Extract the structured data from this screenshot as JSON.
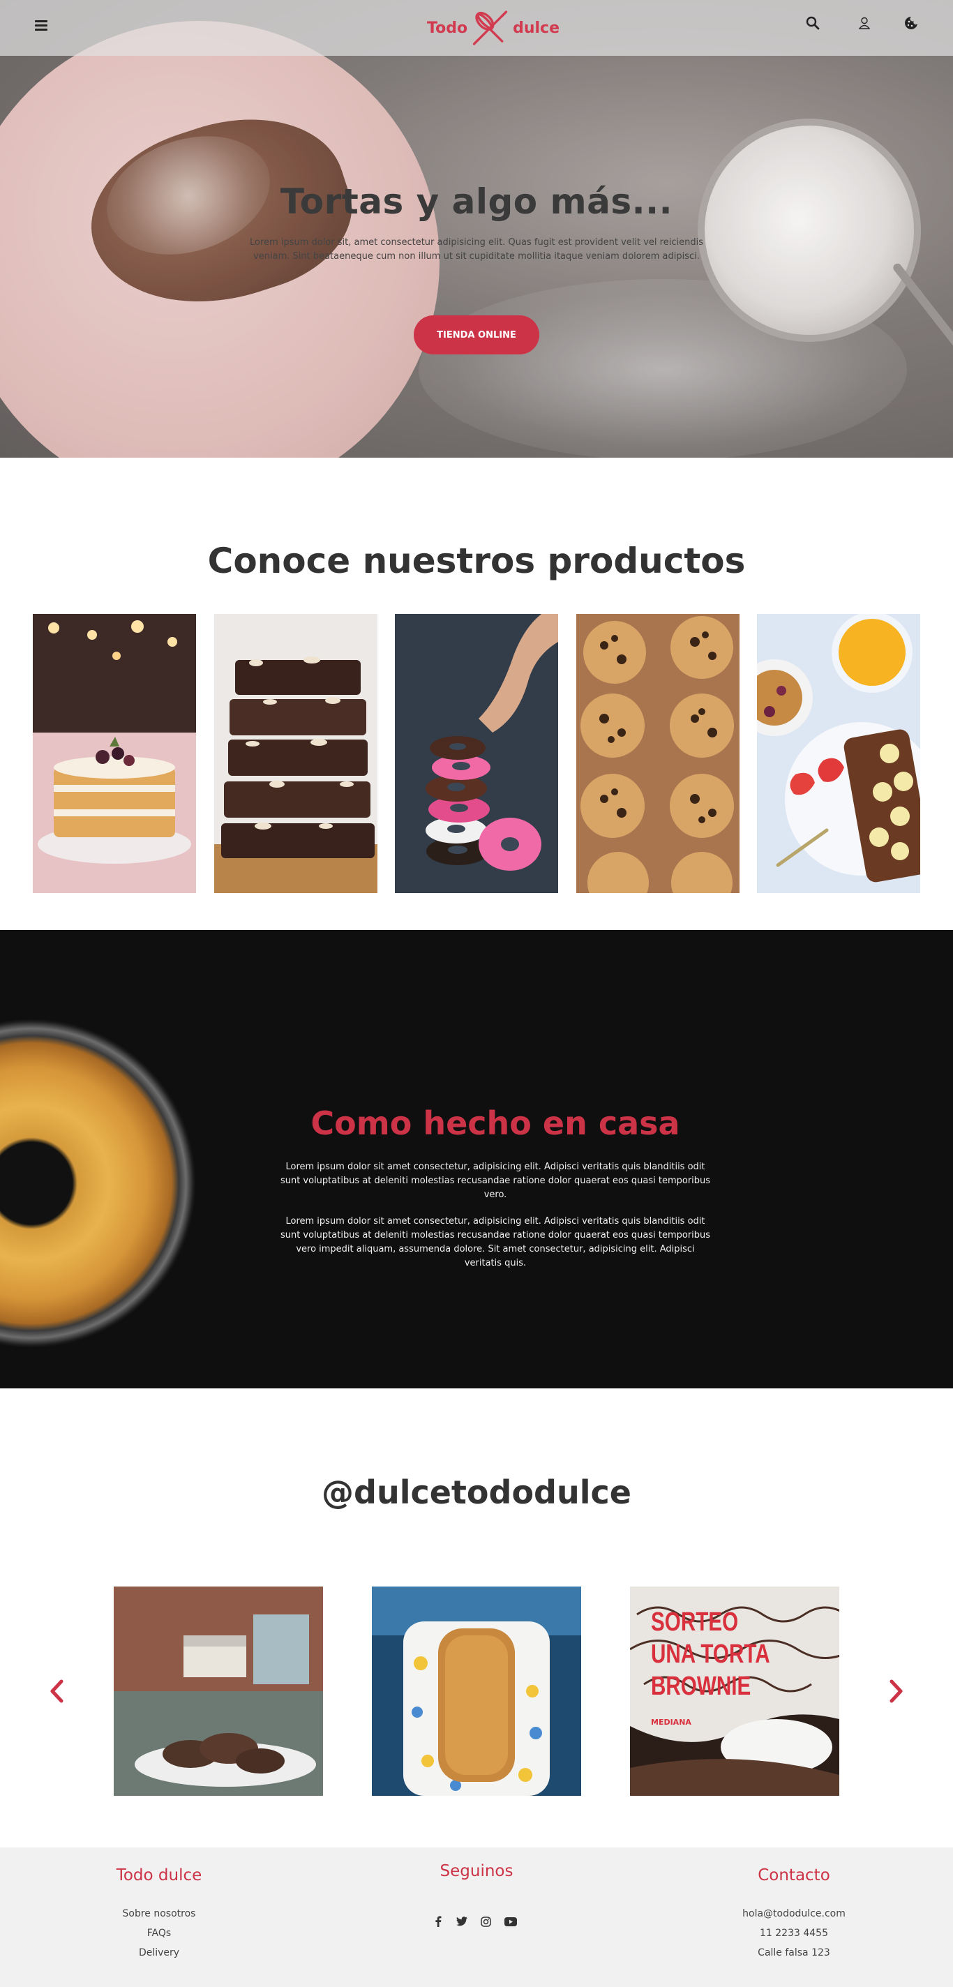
{
  "header": {
    "logo_left": "Todo",
    "logo_right": "dulce",
    "icons": [
      "menu-icon",
      "search-icon",
      "user-icon",
      "cookie-icon"
    ]
  },
  "hero": {
    "title": "Tortas y algo más...",
    "text": "Lorem ipsum dolor sit, amet consectetur adipisicing elit. Quas fugit est provident velit vel reiciendis veniam. Sint beataeneque cum non illum ut sit cupiditate mollitia itaque veniam dolorem adipisci.",
    "button": "TIENDA ONLINE"
  },
  "products": {
    "title": "Conoce nuestros productos",
    "items": [
      "naked-cake",
      "brownies",
      "donuts",
      "cookies",
      "breakfast"
    ]
  },
  "homemade": {
    "title": "Como hecho en casa",
    "p1": "Lorem ipsum dolor sit amet consectetur, adipisicing elit. Adipisci veritatis quis blanditiis odit sunt voluptatibus at deleniti molestias recusandae ratione dolor quaerat eos quasi temporibus vero.",
    "p2": "Lorem ipsum dolor sit amet consectetur, adipisicing elit. Adipisci veritatis quis blanditiis odit sunt voluptatibus at deleniti molestias recusandae ratione dolor quaerat eos quasi temporibus vero impedit aliquam, assumenda dolore. Sit amet consectetur, adipisicing elit. Adipisci veritatis quis."
  },
  "instagram": {
    "title": "@dulcetododulce",
    "posts": [
      {
        "kind": "cookies-photo"
      },
      {
        "kind": "loaf-photo"
      },
      {
        "kind": "sorteo-poster",
        "line1": "SORTEO",
        "line2": "UNA TORTA",
        "line3": "BROWNIE",
        "small": "MEDIANA"
      }
    ]
  },
  "footer": {
    "brand": "Todo dulce",
    "links": [
      "Sobre nosotros",
      "FAQs",
      "Delivery"
    ],
    "follow": "Seguinos",
    "social_icons": [
      "facebook-icon",
      "twitter-icon",
      "instagram-icon",
      "youtube-icon"
    ],
    "contact": "Contacto",
    "email": "hola@tododulce.com",
    "phone": "11 2233 4455",
    "address": "Calle falsa 123"
  },
  "colors": {
    "accent": "#cc3347",
    "dark_section": "#0f0f10",
    "footer_bg": "#f1f1f1"
  }
}
